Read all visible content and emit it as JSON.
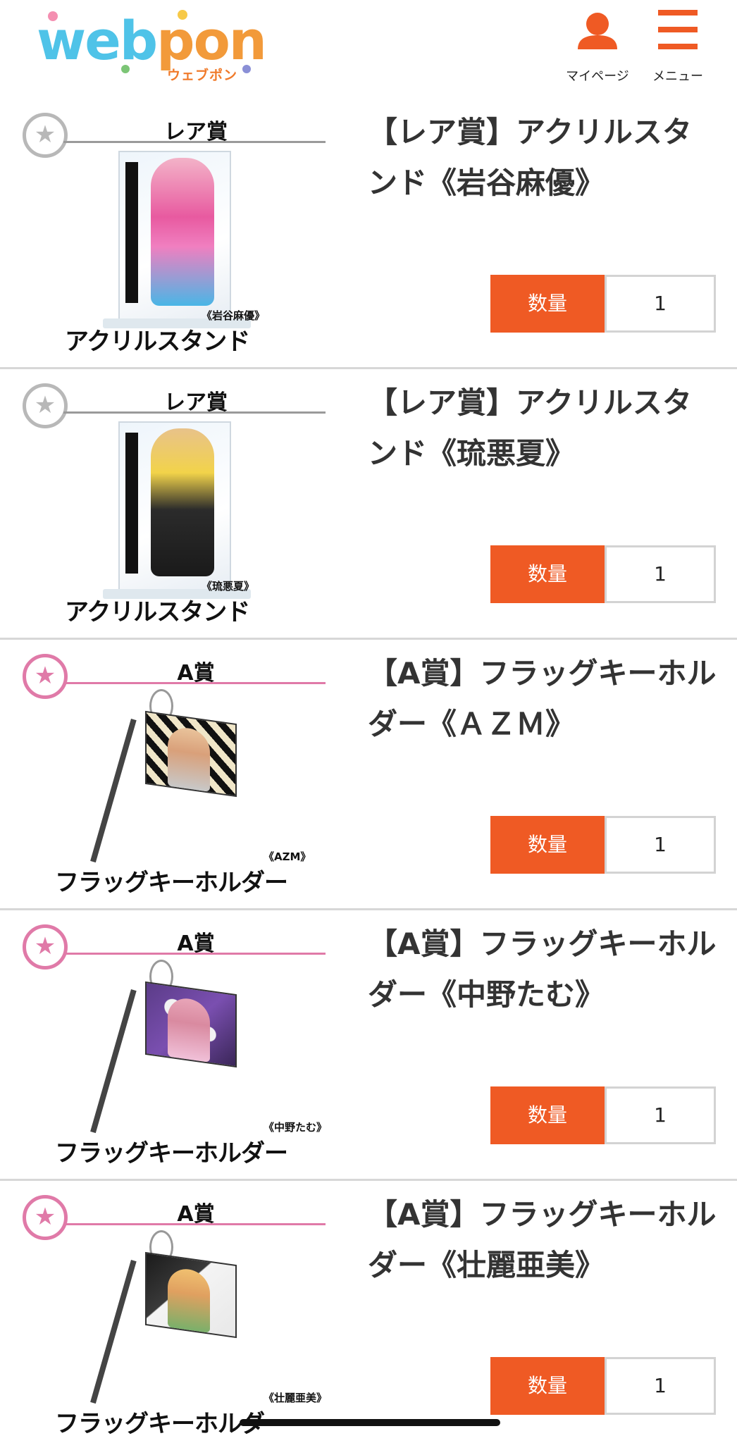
{
  "header": {
    "logo_text": "webpon",
    "logo_sub": "ウェブポン",
    "mypage_label": "マイページ",
    "menu_label": "メニュー",
    "icons": {
      "mypage": "person-icon",
      "menu": "hamburger-menu-icon"
    },
    "colors": {
      "accent": "#ef5a24",
      "logo_blue": "#4fc3e8",
      "logo_orange": "#f29a3a"
    }
  },
  "items": [
    {
      "rank": "レア賞",
      "name_big": "アクリルスタンド",
      "name_small": "《岩谷麻優》",
      "title": "【レア賞】アクリルスタンド《岩谷麻優》",
      "qty_label": "数量",
      "qty_value": "1"
    },
    {
      "rank": "レア賞",
      "name_big": "アクリルスタンド",
      "name_small": "《琉悪夏》",
      "title": "【レア賞】アクリルスタンド《琉悪夏》",
      "qty_label": "数量",
      "qty_value": "1"
    },
    {
      "rank": "A賞",
      "name_big": "フラッグキーホルダー",
      "name_small": "《AZM》",
      "title": "【A賞】フラッグキーホルダー《ＡＺＭ》",
      "qty_label": "数量",
      "qty_value": "1"
    },
    {
      "rank": "A賞",
      "name_big": "フラッグキーホルダー",
      "name_small": "《中野たむ》",
      "title": "【A賞】フラッグキーホルダー《中野たむ》",
      "qty_label": "数量",
      "qty_value": "1"
    },
    {
      "rank": "A賞",
      "name_big": "フラッグキーホルダー",
      "name_small": "《壮麗亜美》",
      "title": "【A賞】フラッグキーホルダー《壮麗亜美》",
      "qty_label": "数量",
      "qty_value": "1"
    }
  ]
}
